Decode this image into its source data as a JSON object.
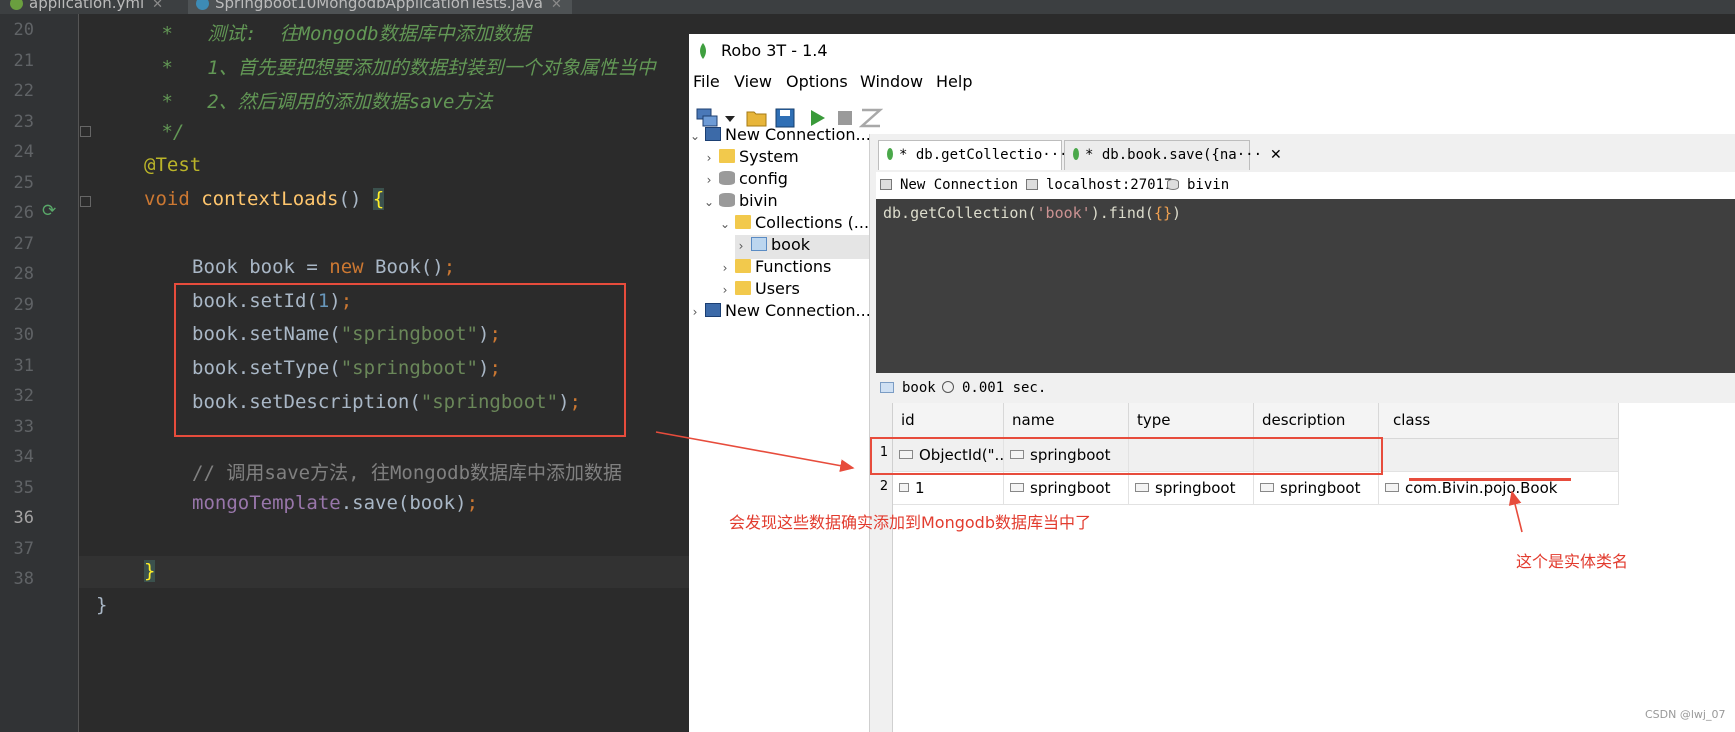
{
  "ide": {
    "tabs": [
      {
        "label": "application.yml"
      },
      {
        "label": "Springboot10MongodbApplicationTests.java"
      }
    ],
    "line_numbers": [
      "20",
      "21",
      "22",
      "23",
      "24",
      "25",
      "26",
      "27",
      "28",
      "29",
      "30",
      "31",
      "32",
      "33",
      "34",
      "35",
      "36",
      "37",
      "38"
    ],
    "code": {
      "l20": {
        "prefix": " *",
        "text": "   测试:  往Mongodb数据库中添加数据"
      },
      "l21": {
        "prefix": " *",
        "text": "   1、首先要把想要添加的数据封装到一个对象属性当中"
      },
      "l22": {
        "prefix": " *",
        "text": "   2、然后调用的添加数据save方法"
      },
      "l23": " */",
      "l24": "@Test",
      "l25": {
        "kw": "void",
        "fn": "contextLoads",
        "rest": "() ",
        "brace": "{"
      },
      "l27": {
        "a": "Book book = ",
        "kw": "new",
        "b": " Book()",
        "semi": ";"
      },
      "l28": {
        "a": "book.setId(",
        "num": "1",
        "b": ")",
        "semi": ";"
      },
      "l29": {
        "a": "book.setName(",
        "str": "\"springboot\"",
        "b": ")",
        "semi": ";"
      },
      "l30": {
        "a": "book.setType(",
        "str": "\"springboot\"",
        "b": ")",
        "semi": ";"
      },
      "l31": {
        "a": "book.setDescription(",
        "str": "\"springboot\"",
        "b": ")",
        "semi": ";"
      },
      "l33": "// 调用save方法, 往Mongodb数据库中添加数据",
      "l34": {
        "field": "mongoTemplate",
        "a": ".save(book)",
        "semi": ";"
      },
      "l36": "}",
      "l37": "}"
    }
  },
  "robo": {
    "title": "Robo 3T - 1.4",
    "menu": [
      "File",
      "View",
      "Options",
      "Window",
      "Help"
    ],
    "toolbar_icons": [
      "connect-icon",
      "dropdown-arrow-icon",
      "open-folder-icon",
      "save-icon",
      "run-icon",
      "stop-icon",
      "format-icon"
    ],
    "tree": [
      {
        "label": "New Connection..."
      },
      {
        "label": "System"
      },
      {
        "label": "config"
      },
      {
        "label": "bivin"
      },
      {
        "label": "Collections (..."
      },
      {
        "label": "book"
      },
      {
        "label": "Functions"
      },
      {
        "label": "Users"
      },
      {
        "label": "New Connection..."
      }
    ],
    "query_tabs": [
      {
        "label": "* db.getCollectio···",
        "close": "✕"
      },
      {
        "label": "* db.book.save({na···",
        "close": "✕"
      }
    ],
    "info_bar": {
      "connection": "New Connection",
      "host": "localhost:27017",
      "database": "bivin"
    },
    "query": {
      "prefix": "db.getCollection(",
      "string": "'book'",
      "mid": ").find(",
      "braces": "{}",
      "suffix": ")"
    },
    "result_bar": {
      "collection": "book",
      "time": "0.001 sec."
    },
    "grid": {
      "columns": [
        "id",
        "name",
        "type",
        "description",
        "class"
      ],
      "rows": [
        {
          "num": "1",
          "cells": [
            "ObjectId(\"...",
            "springboot",
            "",
            "",
            ""
          ]
        },
        {
          "num": "2",
          "cells": [
            "1",
            "springboot",
            "springboot",
            "springboot",
            "com.Bivin.pojo.Book"
          ]
        }
      ]
    }
  },
  "annotations": {
    "note_saved": "会发现这些数据确实添加到Mongodb数据库当中了",
    "note_class": "这个是实体类名"
  },
  "watermark": "CSDN @lwj_07",
  "colors": {
    "annotation_red": "#e74c3c",
    "ide_bg": "#2b2b2b",
    "editor_bg": "#3f3f3f"
  }
}
